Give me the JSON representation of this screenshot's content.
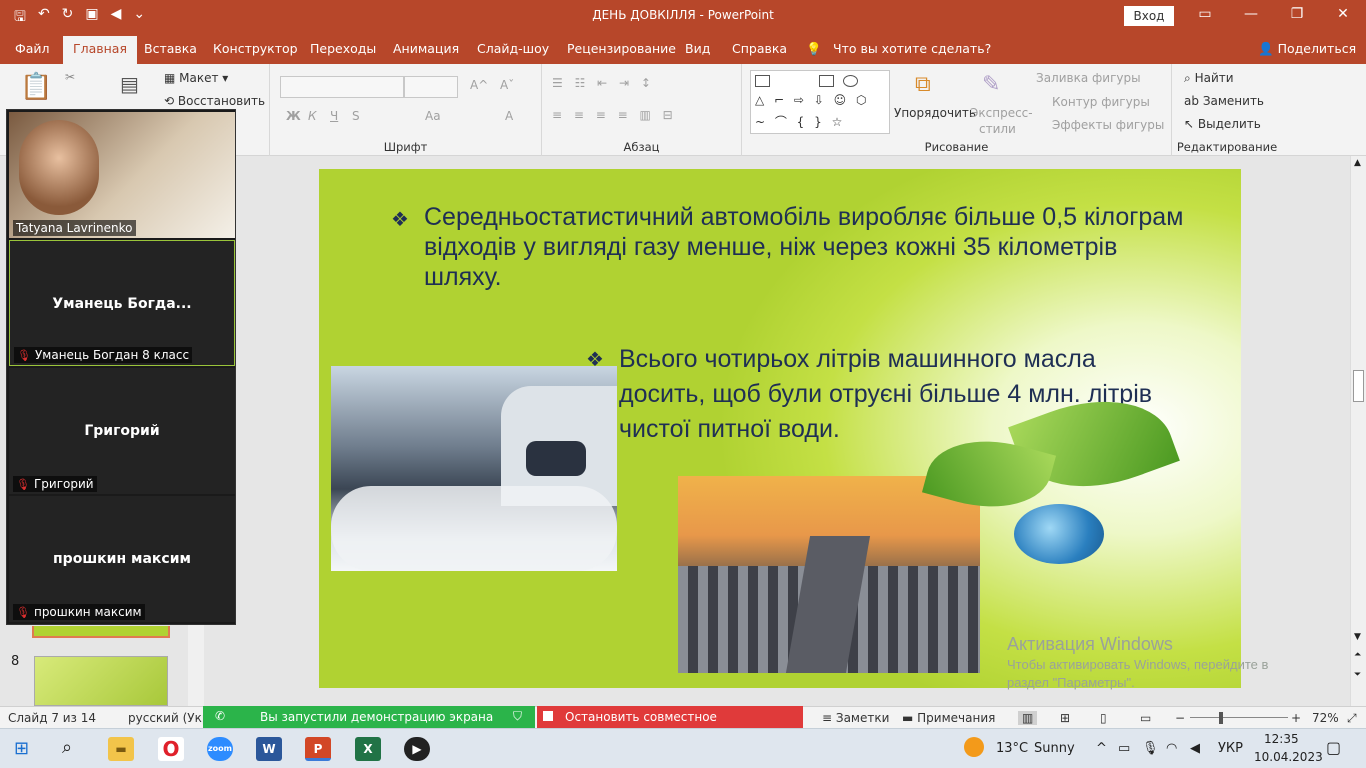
{
  "window": {
    "title": "ДЕНЬ ДОВКІЛЛЯ  -  PowerPoint",
    "login": "Вход",
    "minimize_icon": "minimize-icon",
    "restore_icon": "restore-icon",
    "close_icon": "close-icon"
  },
  "tabs": [
    "Файл",
    "Главная",
    "Вставка",
    "Конструктор",
    "Переходы",
    "Анимация",
    "Слайд-шоу",
    "Рецензирование",
    "Вид",
    "Справка",
    "Что вы хотите сделать?"
  ],
  "share": "Поделиться",
  "ribbon": {
    "slides": {
      "layout": "Макет",
      "reset": "Восстановить"
    },
    "font": {
      "label": "Шрифт",
      "bold": "Ж",
      "italic": "К",
      "underline": "Ч",
      "strike": "S",
      "aa": "Aa",
      "a": "A"
    },
    "paragraph": {
      "label": "Абзац"
    },
    "drawing": {
      "label": "Рисование",
      "arrange": "Упорядочить",
      "express": "Экспресс-",
      "styles": "стили",
      "fill": "Заливка фигуры",
      "outline": "Контур фигуры",
      "effects": "Эффекты фигуры"
    },
    "editing": {
      "label": "Редактирование",
      "find": "Найти",
      "replace": "Заменить",
      "select": "Выделить"
    }
  },
  "video": [
    {
      "name": "Tatyana Lavrinenko",
      "center": ""
    },
    {
      "name": "Уманець Богдан 8 класс",
      "center": "Уманець  Богда..."
    },
    {
      "name": "Григорий",
      "center": "Григорий"
    },
    {
      "name": "прошкин максим",
      "center": "прошкин максим"
    }
  ],
  "thumb_number": "8",
  "slide": {
    "bullet1": "Середньостатистичний автомобіль виробляє більше 0,5 кілограм відходів у вигляді газу менше, ніж через кожні 35 кілометрів шляху.",
    "bullet2": "Всього чотирьох літрів машинного масла досить, щоб були отруєні більше 4 млн. літрів чистої питної води."
  },
  "activation": {
    "title": "Активация Windows",
    "text1": "Чтобы активировать Windows, перейдите в",
    "text2": "раздел \"Параметры\"."
  },
  "status": {
    "slide": "Слайд 7 из 14",
    "lang": "русский (Укра",
    "sharing": "Вы запустили демонстрацию экрана",
    "stop": "Остановить совместное использование",
    "notes": "Заметки",
    "comments": "Примечания",
    "zoom": "72%"
  },
  "taskbar": {
    "weather_temp": "13°C",
    "weather": "Sunny",
    "lang": "УКР",
    "time": "12:35",
    "date": "10.04.2023"
  },
  "colors": {
    "accent": "#b7472a",
    "slide_bg": "#b0d232",
    "text": "#1f2f54"
  }
}
